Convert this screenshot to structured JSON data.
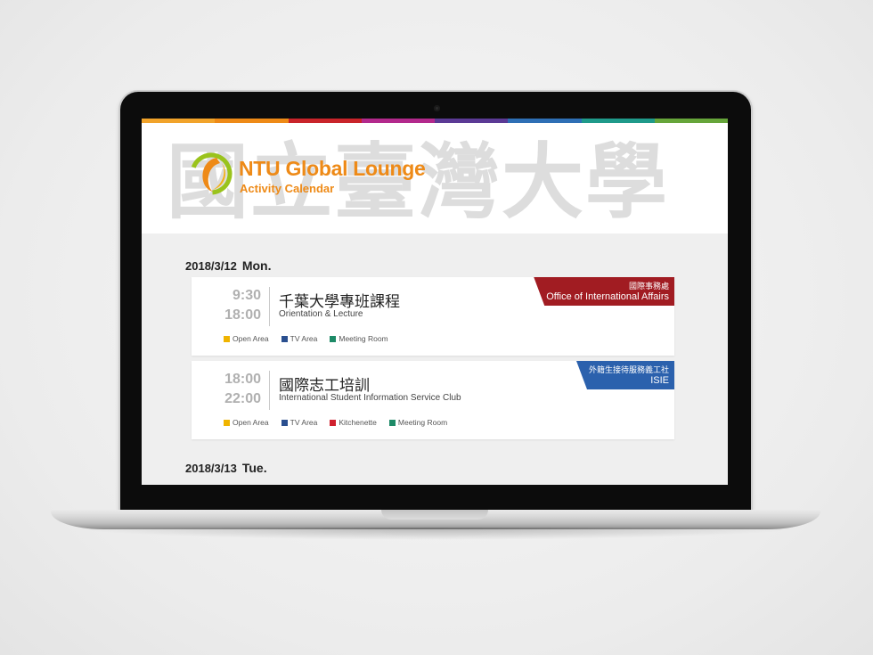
{
  "colors": {
    "bar": [
      "#f1a32a",
      "#ee8a17",
      "#c9242a",
      "#b3298c",
      "#5b3a95",
      "#2e6fb5",
      "#1f9a8a",
      "#66a53a"
    ],
    "accent": "#ee8a17",
    "org_red": "#a11c22",
    "org_blue": "#2b61ad"
  },
  "header": {
    "watermark": "國立臺灣大學",
    "title": "NTU Global Lounge",
    "subtitle": "Activity Calendar",
    "logo_icon": "ntu-swirl-logo"
  },
  "days": [
    {
      "date": "2018/3/12",
      "weekday": "Mon.",
      "events": [
        {
          "start": "9:30",
          "end": "18:00",
          "title": "千葉大學專班課程",
          "subtitle": "Orientation & Lecture",
          "org_zh": "國際事務處",
          "org_en": "Office of International Affairs",
          "org_color": "#a11c22",
          "tags": [
            {
              "label": "Open Area",
              "color": "#f0b400"
            },
            {
              "label": "TV Area",
              "color": "#2a4f8f"
            },
            {
              "label": "Meeting Room",
              "color": "#1d8a67"
            }
          ]
        },
        {
          "start": "18:00",
          "end": "22:00",
          "title": "國際志工培訓",
          "subtitle": "International Student Information Service Club",
          "org_zh": "外籍生接待服務義工社",
          "org_en": "ISIE",
          "org_color": "#2b61ad",
          "tags": [
            {
              "label": "Open Area",
              "color": "#f0b400"
            },
            {
              "label": "TV Area",
              "color": "#2a4f8f"
            },
            {
              "label": "Kitchenette",
              "color": "#d0202e"
            },
            {
              "label": "Meeting Room",
              "color": "#1d8a67"
            }
          ]
        }
      ]
    },
    {
      "date": "2018/3/13",
      "weekday": "Tue.",
      "events": []
    }
  ]
}
